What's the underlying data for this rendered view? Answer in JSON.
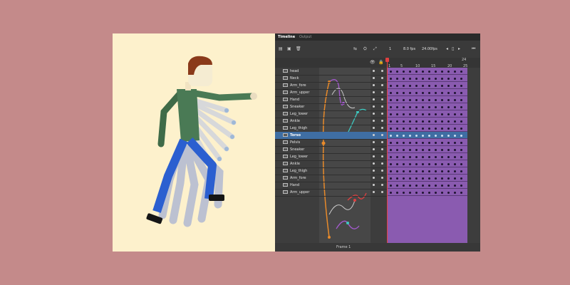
{
  "tabs": [
    {
      "label": "Timeline",
      "active": true
    },
    {
      "label": "Output",
      "active": false
    }
  ],
  "toolbar": {
    "frame_value": "1",
    "fps": "8.0",
    "fps_unit": "fps",
    "duration": "24.00",
    "duration_unit": "fps",
    "ruler_top": "24",
    "ruler": [
      "1",
      "5",
      "10",
      "15",
      "20",
      "25"
    ]
  },
  "layers": [
    {
      "name": "head",
      "selected": false
    },
    {
      "name": "Neck",
      "selected": false
    },
    {
      "name": "Arm_fore",
      "selected": false
    },
    {
      "name": "Arm_upper",
      "selected": false
    },
    {
      "name": "Hand",
      "selected": false
    },
    {
      "name": "Sneaker",
      "selected": false
    },
    {
      "name": "Leg_lower",
      "selected": false
    },
    {
      "name": "Ankle",
      "selected": false
    },
    {
      "name": "Leg_thigh",
      "selected": false
    },
    {
      "name": "Torso",
      "selected": true
    },
    {
      "name": "Pelvis",
      "selected": false
    },
    {
      "name": "Sneaker",
      "selected": false
    },
    {
      "name": "Leg_lower",
      "selected": false
    },
    {
      "name": "Ankle",
      "selected": false
    },
    {
      "name": "Leg_thigh",
      "selected": false
    },
    {
      "name": "Arm_fore",
      "selected": false
    },
    {
      "name": "Hand",
      "selected": false
    },
    {
      "name": "Arm_upper",
      "selected": false
    }
  ],
  "footer": {
    "frame_label": "Frame 1"
  },
  "colors": {
    "background": "#c48a8a",
    "canvas": "#fdf1cc",
    "frames": "#8a5bb0",
    "selected": "#3f6ea3",
    "playhead": "#e04040",
    "shirt": "#4a7a55",
    "jeans": "#2b5fd0",
    "hair": "#8a3a1a"
  }
}
